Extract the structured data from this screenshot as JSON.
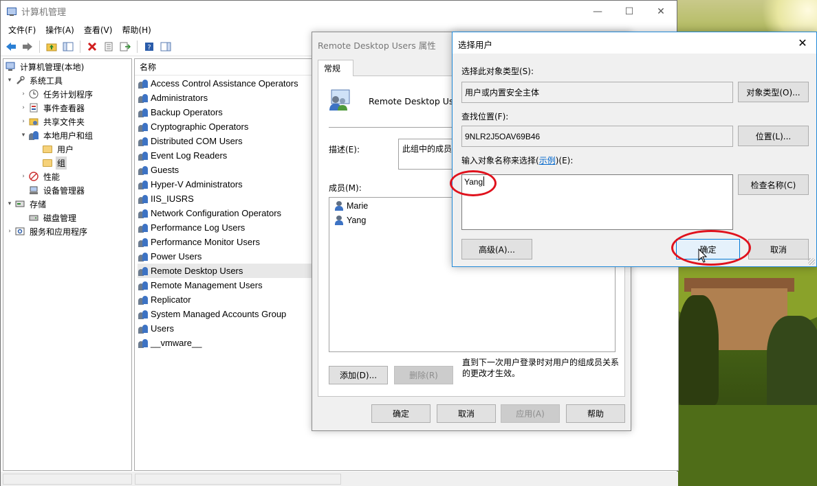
{
  "window": {
    "title": "计算机管理",
    "minimize": "—",
    "maximize": "☐",
    "close": "✕"
  },
  "menu": [
    "文件(F)",
    "操作(A)",
    "查看(V)",
    "帮助(H)"
  ],
  "tree": {
    "root": "计算机管理(本地)",
    "system_tools": "系统工具",
    "task_scheduler": "任务计划程序",
    "event_viewer": "事件查看器",
    "shared_folders": "共享文件夹",
    "local_users_groups": "本地用户和组",
    "users": "用户",
    "groups": "组",
    "performance": "性能",
    "device_manager": "设备管理器",
    "storage": "存储",
    "disk_management": "磁盘管理",
    "services_apps": "服务和应用程序"
  },
  "list": {
    "header": "名称",
    "rows": [
      "Access Control Assistance Operators",
      "Administrators",
      "Backup Operators",
      "Cryptographic Operators",
      "Distributed COM Users",
      "Event Log Readers",
      "Guests",
      "Hyper-V Administrators",
      "IIS_IUSRS",
      "Network Configuration Operators",
      "Performance Log Users",
      "Performance Monitor Users",
      "Power Users",
      "Remote Desktop Users",
      "Remote Management Users",
      "Replicator",
      "System Managed Accounts Group",
      "Users",
      "__vmware__"
    ]
  },
  "props": {
    "title": "Remote Desktop Users 属性",
    "tab": "常规",
    "group_name": "Remote Desktop Use",
    "desc_label": "描述(E):",
    "desc_value": "此组中的成员",
    "members_label": "成员(M):",
    "members": [
      "Marie",
      "Yang"
    ],
    "note": "直到下一次用户登录时对用户的组成员关系的更改才生效。",
    "add": "添加(D)...",
    "remove": "删除(R)",
    "ok": "确定",
    "cancel": "取消",
    "apply": "应用(A)",
    "help": "帮助"
  },
  "select": {
    "title": "选择用户",
    "close": "✕",
    "object_type_label": "选择此对象类型(S):",
    "object_type_value": "用户或内置安全主体",
    "object_types_btn": "对象类型(O)...",
    "location_label": "查找位置(F):",
    "location_value": "9NLR2J5OAV69B46",
    "locations_btn": "位置(L)...",
    "enter_label_prefix": "输入对象名称来选择(",
    "enter_label_link": "示例",
    "enter_label_suffix": ")(E):",
    "enter_value": "Yang",
    "check_names_btn": "检查名称(C)",
    "advanced_btn": "高级(A)...",
    "ok": "确定",
    "cancel": "取消"
  },
  "colors": {
    "annotation": "#e0121d",
    "accent": "#0078d7"
  }
}
